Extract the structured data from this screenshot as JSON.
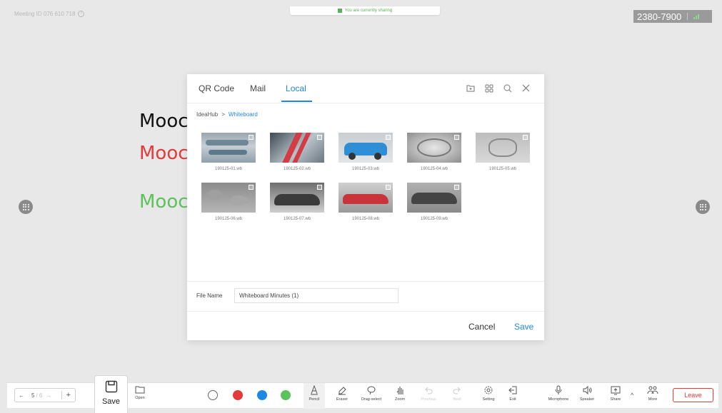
{
  "header": {
    "meeting_id": "Meeting ID 076 610 718",
    "info_glyph": "i",
    "sharing_text": "You are currently sharing",
    "room_number": "2380-7900"
  },
  "canvas": {
    "lines": [
      {
        "text": "Mooc",
        "color": "#111111"
      },
      {
        "text": "Mooc",
        "color": "#e53a3a"
      },
      {
        "text": "Mooc",
        "color": "#5cc25c"
      }
    ]
  },
  "dialog": {
    "tabs": [
      {
        "label": "QR Code",
        "active": false
      },
      {
        "label": "Mail",
        "active": false
      },
      {
        "label": "Local",
        "active": true
      }
    ],
    "tools": [
      "new-folder-icon",
      "grid-view-icon",
      "search-icon",
      "close-icon"
    ],
    "breadcrumb": {
      "root": "IdeaHub",
      "separator": ">",
      "current": "Whiteboard"
    },
    "files": [
      {
        "name": "190125-01.wb"
      },
      {
        "name": "190125-02.wb"
      },
      {
        "name": "190125-03.wb"
      },
      {
        "name": "190125-04.wb"
      },
      {
        "name": "190125-05.wb"
      },
      {
        "name": "190125-06.wb"
      },
      {
        "name": "190125-07.wb"
      },
      {
        "name": "190125-08.wb"
      },
      {
        "name": "190125-09.wb"
      }
    ],
    "file_name_label": "File Name",
    "file_name_value": "Whiteboard Minutes (1)",
    "cancel_label": "Cancel",
    "save_label": "Save"
  },
  "toolbar": {
    "pager": {
      "prev": "←",
      "current": "5",
      "total": "/ 6",
      "next": "→",
      "add": "+"
    },
    "save_label": "Save",
    "open_label": "Open",
    "colors": [
      "#ffffff",
      "#e53a3a",
      "#1e88e5",
      "#5cc25c"
    ],
    "tools": [
      {
        "label": "Pencil"
      },
      {
        "label": "Eraser"
      },
      {
        "label": "Drag-select"
      },
      {
        "label": "Zoom"
      },
      {
        "label": "Previous"
      },
      {
        "label": "Next"
      },
      {
        "label": "Setting"
      },
      {
        "label": "Exit"
      },
      {
        "label": "Microphone"
      },
      {
        "label": "Speaker"
      },
      {
        "label": "Share"
      },
      {
        "label": "More"
      }
    ],
    "caret": "^",
    "leave_label": "Leave"
  }
}
